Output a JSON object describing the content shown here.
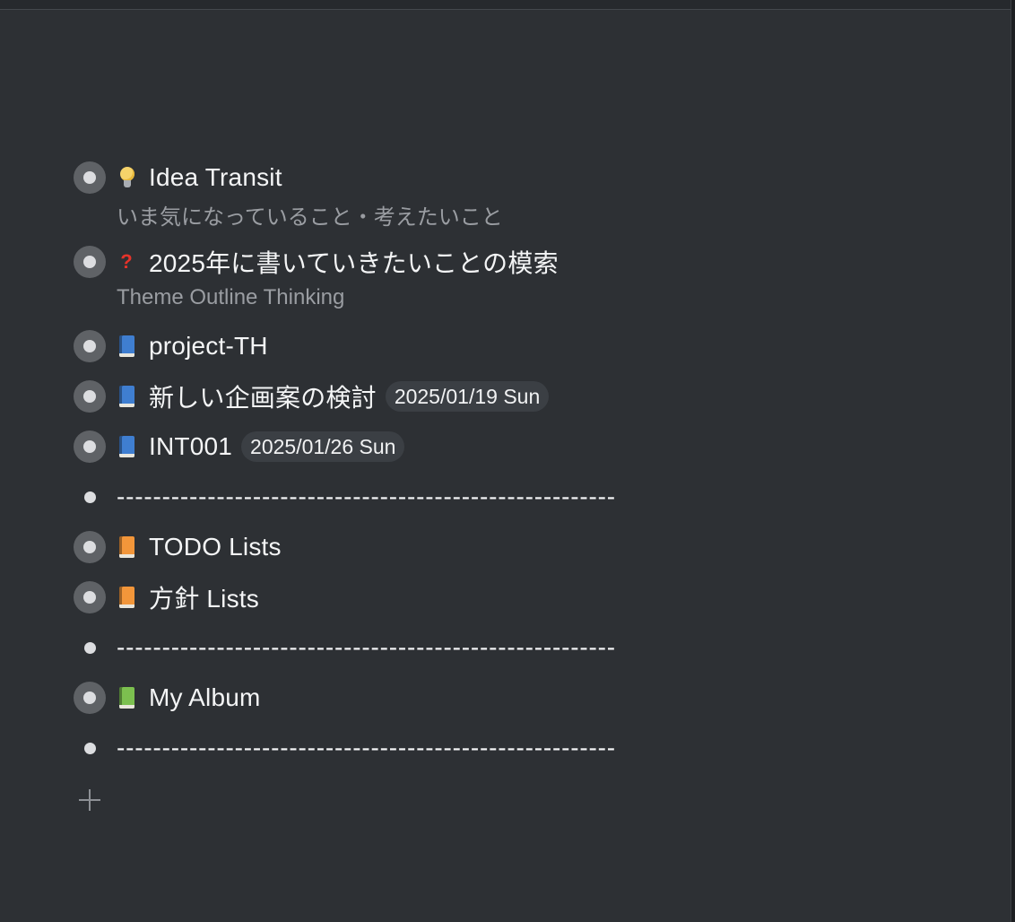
{
  "colors": {
    "background": "#2d3034",
    "text": "#f4f5f6",
    "note_text": "#9a9da2",
    "chip_background": "#3b3f44",
    "collapsed_bullet": "#5f6266"
  },
  "outline": {
    "items": [
      {
        "icon": "lightbulb-icon",
        "title": "Idea Transit",
        "note": "いま気になっていること・考えたいこと",
        "collapsed": true
      },
      {
        "icon": "red-question-mark-icon",
        "title": "2025年に書いていきたいことの模索",
        "note": "Theme Outline Thinking",
        "collapsed": true
      },
      {
        "icon": "blue-book-icon",
        "title": "project-TH",
        "collapsed": true
      },
      {
        "icon": "blue-book-icon",
        "title": "新しい企画案の検討",
        "date": "2025/01/19 Sun",
        "collapsed": true
      },
      {
        "icon": "blue-book-icon",
        "title": "INT001",
        "date": "2025/01/26 Sun",
        "collapsed": true
      },
      {
        "title": "-------------------------------------------------------",
        "collapsed": false
      },
      {
        "icon": "orange-book-icon",
        "title": "TODO Lists",
        "collapsed": true
      },
      {
        "icon": "orange-book-icon",
        "title": "方針 Lists",
        "collapsed": true
      },
      {
        "title": "-------------------------------------------------------",
        "collapsed": false
      },
      {
        "icon": "green-book-icon",
        "title": "My Album",
        "collapsed": true
      },
      {
        "title": "-------------------------------------------------------",
        "collapsed": false
      }
    ]
  },
  "add_button": {
    "icon": "plus-icon"
  }
}
